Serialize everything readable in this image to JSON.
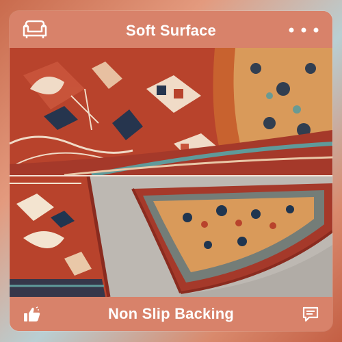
{
  "header": {
    "title": "Soft Surface",
    "left_icon": "sofa-icon",
    "right_icon": "more-dots-icon"
  },
  "footer": {
    "title": "Non Slip Backing",
    "left_icon": "thumbs-up-icon",
    "right_icon": "comment-icon"
  },
  "images": [
    {
      "name": "rug-rolled-soft-surface",
      "content": "rolled red persian-style rug"
    },
    {
      "name": "rug-non-slip-backing",
      "content": "rug corner folded over showing gray backing"
    }
  ],
  "colors": {
    "panel": "#d8826a",
    "rug_red": "#b8432c",
    "rug_navy": "#1f3550",
    "rug_teal": "#5f9a9a",
    "backing_gray": "#bdb8b2"
  }
}
